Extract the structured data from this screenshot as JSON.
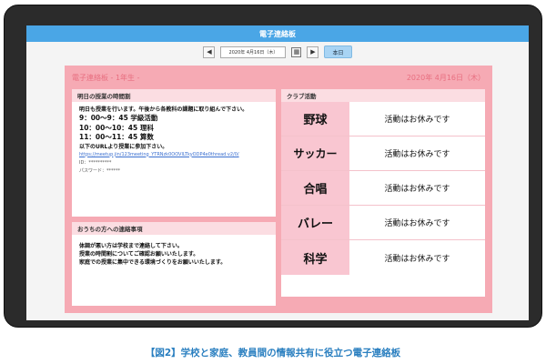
{
  "app": {
    "title": "電子連絡板"
  },
  "nav": {
    "prev": "◀",
    "next": "▶",
    "date": "2020年 4月16日（木）",
    "calendar_icon": "calendar-icon",
    "today_label": "本日"
  },
  "board": {
    "title": "電子連絡板 - 1年生 -",
    "date": "2020年 4月16日（木）"
  },
  "schedule": {
    "heading": "明日の授業の時間割",
    "intro": "明日も授業を行います。午後から各教科の課題に取り組んで下さい。",
    "periods": [
      "9：00〜9：45 学級活動",
      "10：00〜10：45 理科",
      "11：00〜11：45 算数"
    ],
    "url_note": "以下のURLより授業に参加下さい。",
    "url": "https://meetup.jin/123meeting_YTRNzk0OOVlLTkyODP4e0thread.v2/0/",
    "id_label": "ID：**********",
    "password_label": "パスワード：******"
  },
  "notice": {
    "heading": "おうちの方への連絡事項",
    "lines": [
      "体調が悪い方は学校まで連絡して下さい。",
      "授業の時間割についてご確認お願いいたします。",
      "家庭での授業に集中できる環境づくりをお願いいたします。"
    ]
  },
  "clubs": {
    "heading": "クラブ活動",
    "items": [
      {
        "name": "野球",
        "status": "活動はお休みです"
      },
      {
        "name": "サッカー",
        "status": "活動はお休みです"
      },
      {
        "name": "合唱",
        "status": "活動はお休みです"
      },
      {
        "name": "バレー",
        "status": "活動はお休みです"
      },
      {
        "name": "科学",
        "status": "活動はお休みです"
      }
    ]
  },
  "caption": "【図2】学校と家庭、教員間の情報共有に役立つ電子連絡板"
}
